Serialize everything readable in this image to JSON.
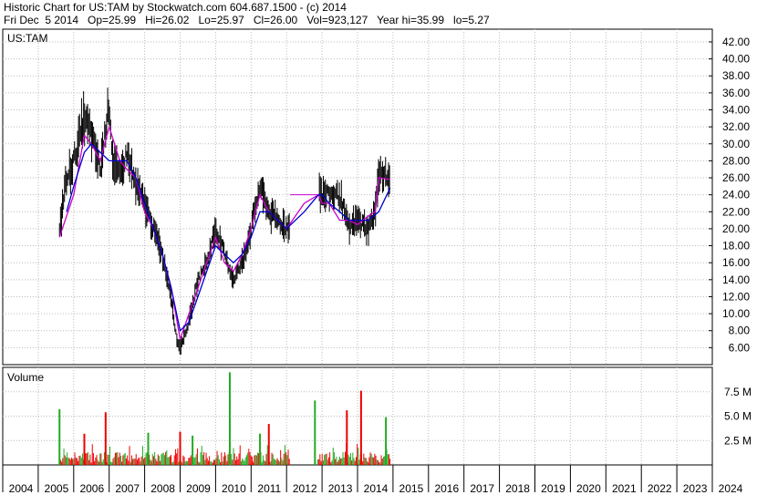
{
  "header": {
    "line1": "Historic Chart for US:TAM by Stockwatch.com 604.687.1500 - (c) 2014",
    "line2": "Fri Dec  5 2014   Op=25.99   Hi=26.02   Lo=25.97   Cl=26.00   Vol=923,127   Year hi=35.99   lo=5.27"
  },
  "colors": {
    "price": "#000000",
    "ma_short": "#cc00cc",
    "ma_long": "#0000cc",
    "vol_up": "#22aa22",
    "vol_down": "#ee0000",
    "grid": "#bbbbbb"
  },
  "chart_data": [
    {
      "type": "line",
      "title": "US:TAM",
      "ylim": [
        4,
        43.5
      ],
      "xlim": [
        2004,
        2024
      ],
      "yticks": [
        "42.00",
        "40.00",
        "38.00",
        "36.00",
        "34.00",
        "32.00",
        "30.00",
        "28.00",
        "26.00",
        "24.00",
        "22.00",
        "20.00",
        "18.00",
        "16.00",
        "14.00",
        "12.00",
        "10.00",
        "8.00",
        "6.00"
      ],
      "ytick_values": [
        42,
        40,
        38,
        36,
        34,
        32,
        30,
        28,
        26,
        24,
        22,
        20,
        18,
        16,
        14,
        12,
        10,
        8,
        6
      ],
      "x_labels": [
        "2004",
        "2005",
        "2006",
        "2007",
        "2008",
        "2009",
        "2010",
        "2011",
        "2012",
        "2013",
        "2014",
        "2015",
        "2016",
        "2017",
        "2018",
        "2019",
        "2020",
        "2021",
        "2022",
        "2023",
        "2024"
      ],
      "grid": true,
      "series": [
        {
          "key": "price",
          "x": [
            2004.6,
            2005.6,
            2005.75,
            2006.0,
            2006.3,
            2006.5,
            2006.75,
            2007.0,
            2007.1,
            2007.3,
            2007.5,
            2007.75,
            2008.0,
            2008.25,
            2008.5,
            2008.75,
            2008.9,
            2009.0,
            2009.25,
            2009.5,
            2009.75,
            2010.0,
            2010.25,
            2010.5,
            2010.75,
            2011.0,
            2011.25,
            2011.5,
            2011.75,
            2012.0,
            2012.1,
            2012.5,
            2012.9,
            2013.0,
            2013.2,
            2013.5,
            2013.75,
            2014.0,
            2014.3,
            2014.5,
            2014.6,
            2014.8,
            2014.92
          ],
          "y": [
            19,
            19.5,
            25,
            28,
            33,
            31,
            27,
            35,
            28,
            26,
            29,
            25,
            23,
            20,
            17,
            12,
            7,
            6,
            9,
            14,
            16,
            20,
            17,
            14,
            16,
            20,
            25,
            22,
            21,
            20,
            21,
            24,
            25,
            24,
            24,
            24,
            20,
            21,
            20,
            22,
            27,
            26,
            26
          ]
        },
        {
          "key": "ma_short",
          "x": [
            2005.6,
            2006.0,
            2006.3,
            2006.5,
            2006.75,
            2007.0,
            2007.3,
            2007.5,
            2007.75,
            2008.0,
            2008.25,
            2008.5,
            2008.75,
            2009.0,
            2009.25,
            2009.5,
            2009.75,
            2010.0,
            2010.25,
            2010.5,
            2010.75,
            2011.0,
            2011.25,
            2011.5,
            2011.75,
            2012.0,
            2012.5,
            2012.9,
            2013.0,
            2013.2,
            2013.5,
            2013.75,
            2014.0,
            2014.3,
            2014.5,
            2014.6,
            2014.92
          ],
          "y": [
            19,
            24,
            31,
            30,
            28,
            32,
            28,
            27,
            26,
            22,
            20,
            17,
            13,
            7,
            10,
            13,
            16,
            19,
            16,
            15,
            17,
            20,
            24,
            22,
            21,
            20,
            23,
            24,
            23,
            23,
            21,
            21,
            20.5,
            21.5,
            22,
            26,
            25.8
          ]
        },
        {
          "key": "ma_long",
          "x": [
            2005.8,
            2006.0,
            2006.3,
            2006.5,
            2006.75,
            2007.0,
            2007.3,
            2007.5,
            2007.75,
            2008.0,
            2008.25,
            2008.5,
            2008.75,
            2009.0,
            2009.25,
            2009.5,
            2009.75,
            2010.0,
            2010.25,
            2010.5,
            2010.75,
            2011.0,
            2011.25,
            2011.5,
            2011.75,
            2012.0,
            2012.5,
            2012.9,
            2013.0,
            2013.2,
            2013.5,
            2013.75,
            2014.0,
            2014.3,
            2014.6,
            2014.92
          ],
          "y": [
            22,
            25,
            29,
            30,
            29,
            28,
            28,
            28,
            26,
            23,
            20,
            17,
            13,
            8,
            9,
            12,
            15,
            18,
            17,
            16,
            17,
            19,
            22,
            22,
            21,
            20,
            22,
            24,
            24,
            23,
            22,
            21,
            21,
            21,
            22,
            24.8
          ]
        }
      ]
    },
    {
      "type": "bar",
      "title": "Volume",
      "ylim": [
        0,
        10
      ],
      "y_unit": "M",
      "yticks": [
        "7.5 M",
        "5.0 M",
        "2.5 M"
      ],
      "ytick_values": [
        7.5,
        5.0,
        2.5
      ],
      "spikes": [
        {
          "x": 2005.6,
          "value": 5.7,
          "dir": "up"
        },
        {
          "x": 2006.3,
          "value": 3.2,
          "dir": "down"
        },
        {
          "x": 2006.9,
          "value": 5.4,
          "dir": "down"
        },
        {
          "x": 2008.1,
          "value": 3.3,
          "dir": "up"
        },
        {
          "x": 2009.0,
          "value": 3.4,
          "dir": "down"
        },
        {
          "x": 2009.35,
          "value": 3.0,
          "dir": "up"
        },
        {
          "x": 2010.4,
          "value": 9.5,
          "dir": "up"
        },
        {
          "x": 2011.25,
          "value": 3.2,
          "dir": "up"
        },
        {
          "x": 2011.5,
          "value": 4.2,
          "dir": "down"
        },
        {
          "x": 2012.8,
          "value": 6.6,
          "dir": "up"
        },
        {
          "x": 2013.7,
          "value": 5.6,
          "dir": "down"
        },
        {
          "x": 2014.1,
          "value": 7.6,
          "dir": "down"
        },
        {
          "x": 2014.8,
          "value": 4.9,
          "dir": "up"
        }
      ]
    }
  ]
}
